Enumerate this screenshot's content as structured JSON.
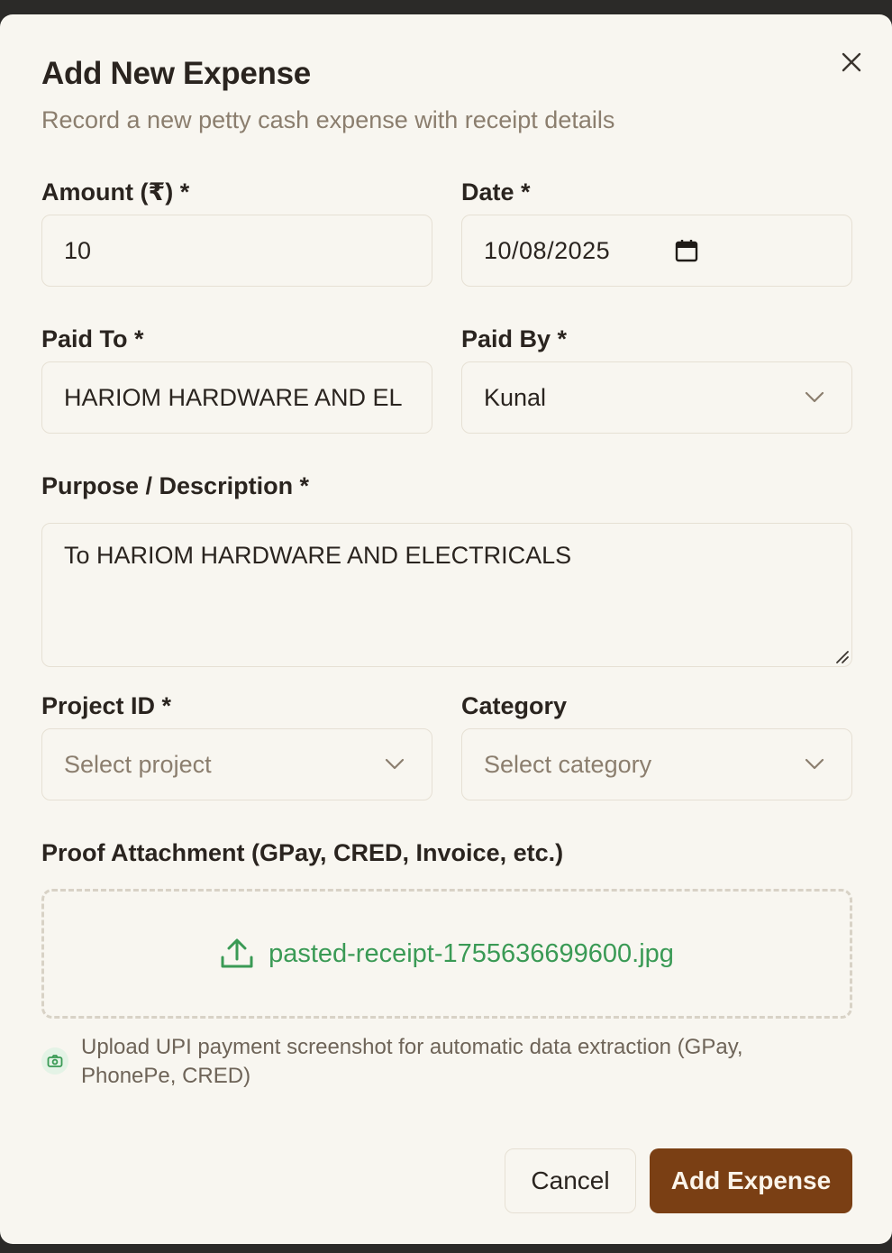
{
  "dialog": {
    "title": "Add New Expense",
    "subtitle": "Record a new petty cash expense with receipt details"
  },
  "form": {
    "amount": {
      "label": "Amount (₹) *",
      "value": "10"
    },
    "date": {
      "label": "Date *",
      "value": "10/08/2025"
    },
    "paid_to": {
      "label": "Paid To *",
      "value": "HARIOM HARDWARE AND EL"
    },
    "paid_by": {
      "label": "Paid By *",
      "value": "Kunal"
    },
    "purpose": {
      "label": "Purpose / Description *",
      "value": "To HARIOM HARDWARE AND ELECTRICALS"
    },
    "project": {
      "label": "Project ID *",
      "placeholder": "Select project"
    },
    "category": {
      "label": "Category",
      "placeholder": "Select category"
    },
    "attachment": {
      "label": "Proof Attachment (GPay, CRED, Invoice, etc.)",
      "filename": "pasted-receipt-1755636699600.jpg",
      "hint": "Upload UPI payment screenshot for automatic data extraction (GPay, PhonePe, CRED)"
    }
  },
  "actions": {
    "cancel_label": "Cancel",
    "submit_label": "Add Expense"
  },
  "colors": {
    "primary": "#7a3f14",
    "accent_green": "#3a9a55",
    "background": "#f8f6f0"
  },
  "icons": {
    "close": "close-icon",
    "calendar": "calendar-icon",
    "chevron": "chevron-down-icon",
    "upload": "upload-icon",
    "camera": "camera-icon"
  }
}
